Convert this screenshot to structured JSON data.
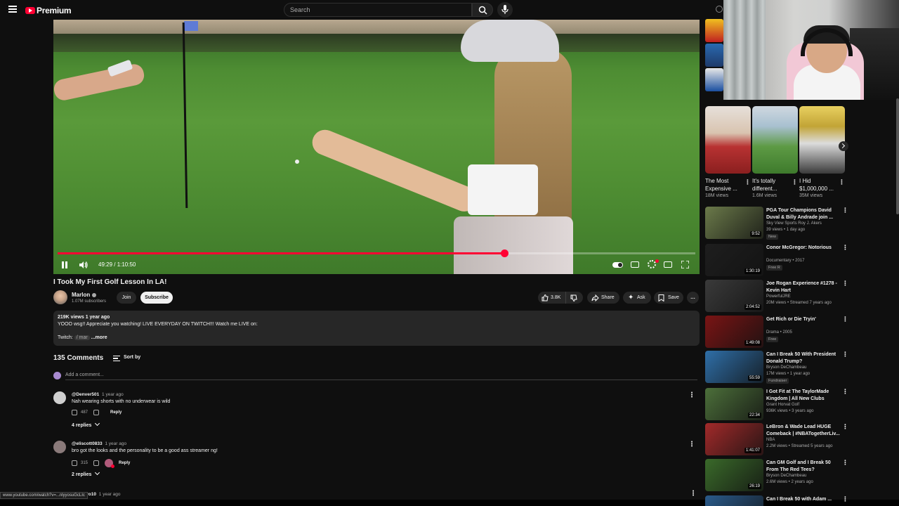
{
  "header": {
    "logo_text": "Premium",
    "search_placeholder": "Search"
  },
  "player": {
    "time_display": "49:29 / 1:10:50",
    "progress_fraction": 0.7,
    "autoplay_on": true
  },
  "video": {
    "title": "I Took My First Golf Lesson In LA!",
    "channel_name": "Marlon",
    "subscribers": "1.07M subscribers",
    "join_label": "Join",
    "subscribe_label": "Subscribe",
    "likes": "3.8K",
    "share_label": "Share",
    "ask_label": "Ask",
    "save_label": "Save",
    "more_label": "…"
  },
  "description": {
    "stats": "219K views  1 year ago",
    "text": "YOOO wsg!! Appreciate you watching! LIVE EVERYDAY ON TWITCH!!! Watch me LIVE on:",
    "twitch_label": "Twitch:",
    "twitch_link": "/ mar",
    "more_label": "...more"
  },
  "comments": {
    "count_label": "135 Comments",
    "sort_label": "Sort by",
    "add_placeholder": "Add a comment...",
    "reply_label": "Reply",
    "items": [
      {
        "author": "@Denver501",
        "time": "1 year ago",
        "text": "Nah wearing shorts with no underwear is wild",
        "likes": "487",
        "replies": "4 replies",
        "avatar_color": "#cfcfcf"
      },
      {
        "author": "@eliscott0833",
        "time": "1 year ago",
        "text": "bro got the looks and the personality to be a good ass streamer ng!",
        "likes": "315",
        "replies": "2 replies",
        "avatar_color": "#8a7a7a"
      }
    ],
    "third_author": "eero10",
    "third_time": "1 year ago"
  },
  "status_url": "www.youtube.com/watch?v=...nlyyosuGcLIc",
  "shorts": [
    {
      "title": "The Most Expensive ...",
      "views": "18M views",
      "color": "#b83232"
    },
    {
      "title": "It's totally different...",
      "views": "1.6M views",
      "color": "#4b8a3a"
    },
    {
      "title": "I Hid $1,000,000 ...",
      "views": "35M views",
      "color": "#c2a436"
    }
  ],
  "recommendations": [
    {
      "title": "PGA Tour Champions David Duval & Billy Andrade join ...",
      "channel": "Sky View Sports Roy J. Akers",
      "stats": "39 views • 1 day ago",
      "badge": "New",
      "duration": "9:52",
      "color": "#6b7a4a"
    },
    {
      "title": "Conor McGregor: Notorious",
      "channel": "Documentary • 2017",
      "stats": "",
      "badge": "Free  R",
      "duration": "1:30:19",
      "color": "#1e1e1e"
    },
    {
      "title": "Joe Rogan Experience #1278 - Kevin Hart",
      "channel": "PowerfulJRE",
      "stats": "20M views • Streamed 7 years ago",
      "badge": "",
      "duration": "2:04:52",
      "color": "#3a3a3a"
    },
    {
      "title": "Get Rich or Die Tryin'",
      "channel": "Drama • 2005",
      "stats": "",
      "badge": "Free",
      "duration": "1:49:08",
      "color": "#7a1414"
    },
    {
      "title": "Can I Break 50 With President Donald Trump?",
      "channel": "Bryson DeChambeau",
      "stats": "17M views • 1 year ago",
      "badge": "Fundraiser",
      "duration": "55:59",
      "color": "#2f6fa8"
    },
    {
      "title": "I Got Fit at The TaylorMade Kingdom | All New Clubs",
      "channel": "Grant Horvat Golf",
      "stats": "936K views • 3 years ago",
      "badge": "",
      "duration": "22:34",
      "color": "#4c6f3a"
    },
    {
      "title": "LeBron & Wade Lead HUGE Comeback | #NBATogetherLiv...",
      "channel": "NBA",
      "stats": "2.2M views • Streamed 5 years ago",
      "badge": "",
      "duration": "1:41:07",
      "color": "#a22a2a"
    },
    {
      "title": "Can GM Golf and I Break 50 From The Red Tees?",
      "channel": "Bryson DeChambeau",
      "stats": "2.6M views • 2 years ago",
      "badge": "",
      "duration": "26:19",
      "color": "#3a6a2a"
    },
    {
      "title": "Can I Break 50 with Adam ...",
      "channel": "",
      "stats": "",
      "badge": "",
      "duration": "",
      "color": "#2a5a8a"
    }
  ]
}
